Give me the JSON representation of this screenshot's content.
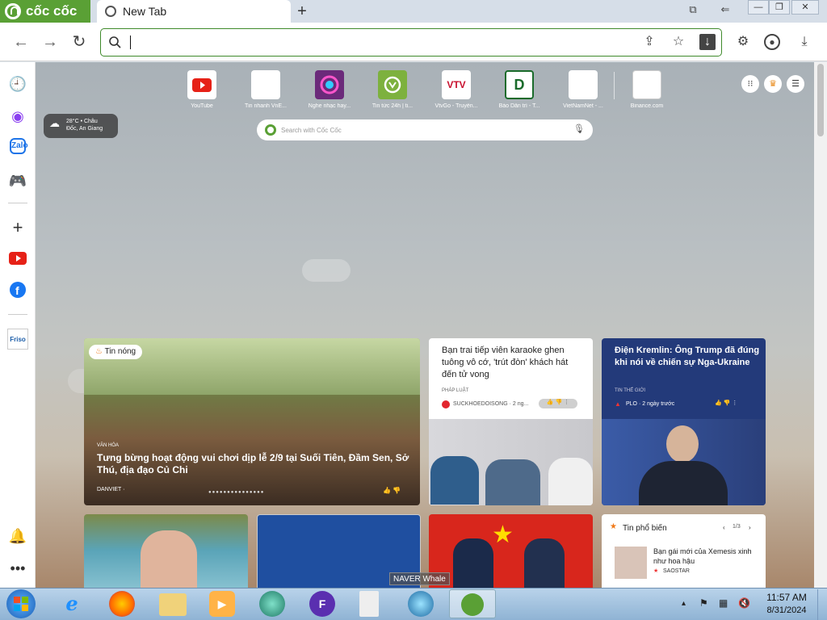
{
  "browser": {
    "brand": "cốc cốc",
    "tab_title": "New Tab",
    "newtab_symbol": "+",
    "window_controls": [
      "—",
      "❐",
      "✕"
    ],
    "address_value": ""
  },
  "speed_dial": [
    {
      "label": "YouTube",
      "color": "#ffffff",
      "icon": "youtube-icon"
    },
    {
      "label": "Tin nhanh VnE...",
      "color": "#ffffff",
      "icon": "vnexpress-icon"
    },
    {
      "label": "Nghe nhạc hay...",
      "color": "#6b2a7a",
      "icon": "music-icon"
    },
    {
      "label": "Tin tức 24h | ti...",
      "color": "#7db13e",
      "icon": "news24-icon"
    },
    {
      "label": "VtvGo - Truyền...",
      "color": "#ffffff",
      "icon": "vtvgo-icon"
    },
    {
      "label": "Báo Dân trí - T...",
      "color": "#ffffff",
      "icon": "dantri-icon"
    },
    {
      "label": "VietNamNet - ...",
      "color": "#ffffff",
      "icon": "vietnamnet-icon"
    },
    {
      "label": "Binance.com",
      "color": "#ffffff",
      "icon": "binance-icon"
    }
  ],
  "weather": {
    "line1": "28°C • Châu",
    "line2": "Đốc, An Giang"
  },
  "search": {
    "placeholder": "Search with Cốc Cốc"
  },
  "cards": {
    "hero": {
      "badge": "Tin nóng",
      "category": "VĂN HÓA",
      "title": "Tưng bừng hoạt động vui chơi dịp lễ 2/9 tại Suối Tiên, Đầm Sen, Sở Thú, địa đạo Củ Chi",
      "source": "DANVIET ·"
    },
    "card2": {
      "title": "Bạn trai tiếp viên karaoke ghen tuông vô cớ, 'trút đòn' khách hát đến tử vong",
      "category": "PHÁP LUẬT",
      "source": "SUCKHOEDOISONG · 2 ng..."
    },
    "card3": {
      "title": "Điện Kremlin: Ông Trump đã đúng khi nói về chiến sự Nga-Ukraine",
      "category": "TIN THẾ GIỚI",
      "source": "PLO · 2 ngày trước"
    },
    "trending": {
      "heading": "Tin phổ biến",
      "page": "1/3",
      "item_title": "Bạn gái mới của Xemesis xinh như hoa hậu",
      "item_source": "SAOSTAR"
    }
  },
  "taskbar": {
    "tooltip": "NAVER Whale",
    "time": "11:57 AM",
    "date": "8/31/2024"
  },
  "colors": {
    "accent": "#5aa035",
    "omnibox_border": "#3f8a2b",
    "card3_bg": "#233a7a"
  }
}
